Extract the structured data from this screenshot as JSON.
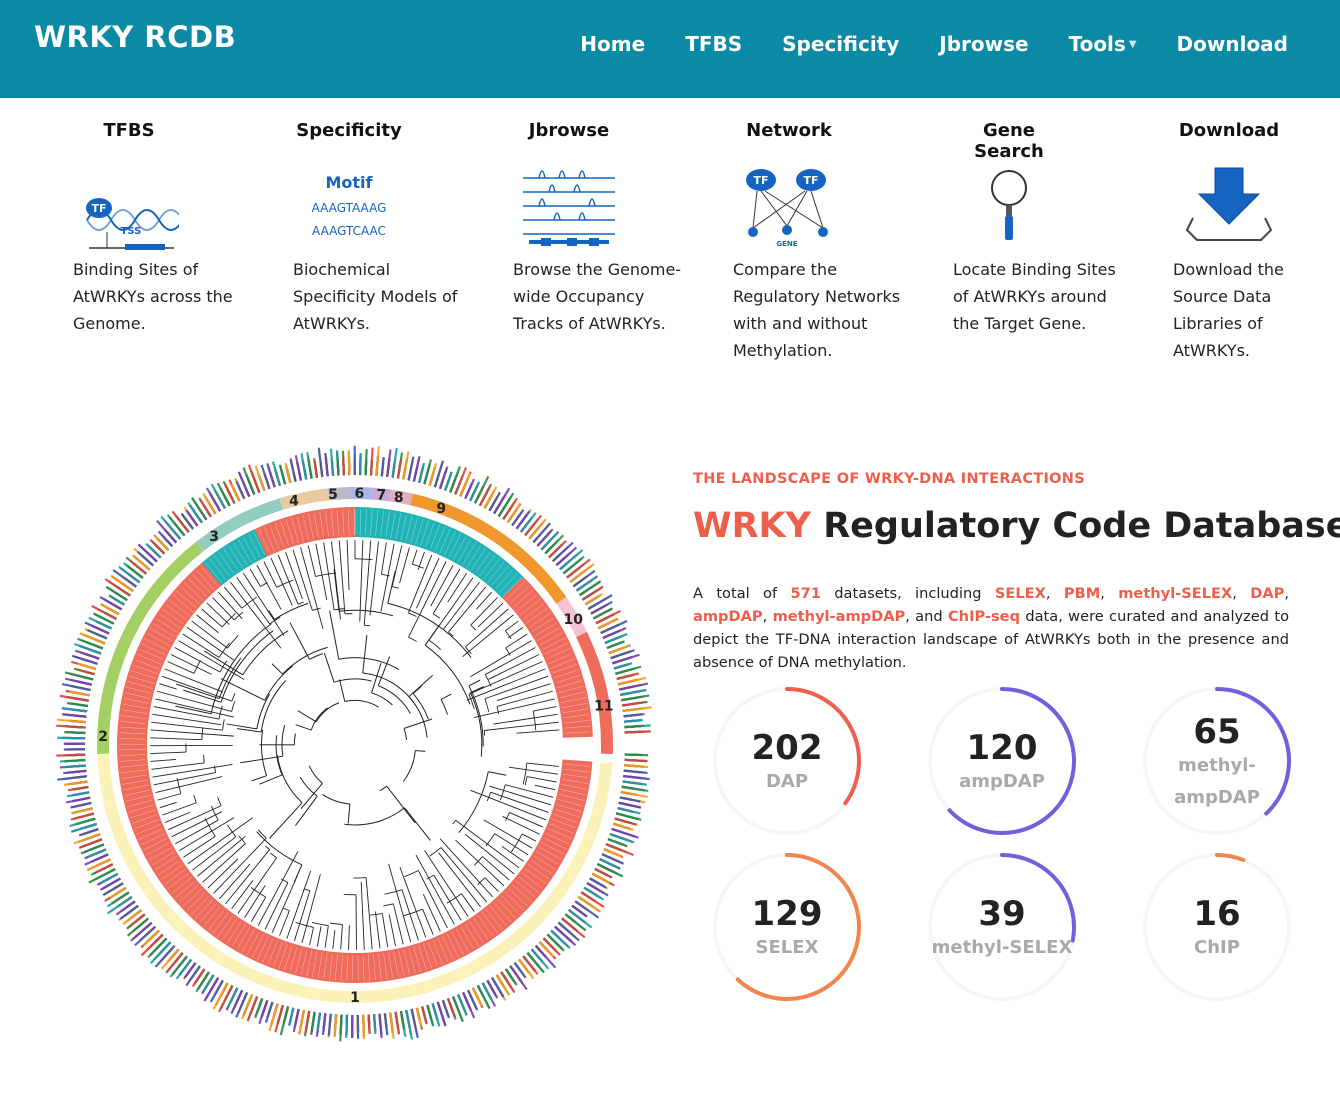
{
  "nav": {
    "brand": "WRKY RCDB",
    "items": [
      {
        "label": "Home"
      },
      {
        "label": "TFBS"
      },
      {
        "label": "Specificity"
      },
      {
        "label": "Jbrowse"
      },
      {
        "label": "Tools",
        "has_caret": true
      },
      {
        "label": "Download"
      }
    ]
  },
  "features": [
    {
      "title": "TFBS",
      "icon": "tfbs-icon",
      "desc": "Binding Sites of AtWRKYs across the Genome."
    },
    {
      "title": "Specificity",
      "icon": "motif-icon",
      "desc": "Biochemical Specificity Models of AtWRKYs."
    },
    {
      "title": "Jbrowse",
      "icon": "tracks-icon",
      "desc": "Browse the Genome-wide Occupancy Tracks of AtWRKYs."
    },
    {
      "title": "Network",
      "icon": "network-icon",
      "desc": "Compare the Regulatory Networks with and without Methylation."
    },
    {
      "title": "Gene Search",
      "icon": "magnifier-icon",
      "desc": "Locate Binding Sites of AtWRKYs around the Target Gene."
    },
    {
      "title": "Download",
      "icon": "download-icon",
      "desc": "Download the Source Data Libraries of AtWRKYs."
    }
  ],
  "icon_text": {
    "tf": "TF",
    "tss": "TSS",
    "gene": "GENE",
    "motif": "Motif",
    "seq1": "AAAGTAAAG",
    "seq2": "AAAGTCAAC"
  },
  "circle_clusters": [
    "1",
    "2",
    "3",
    "4",
    "5",
    "6",
    "7",
    "8",
    "9",
    "10",
    "11"
  ],
  "landscape": {
    "eyebrow": "THE LANDSCAPE OF WRKY-DNA INTERACTIONS",
    "title_highlight": "WRKY",
    "title_rest": " Regulatory Code Database",
    "desc": {
      "p1": "A total of ",
      "count": "571",
      "p2": " datasets, including ",
      "t1": "SELEX",
      "t2": "PBM",
      "t3": "methyl-SELEX",
      "t4": "DAP",
      "t5": "ampDAP",
      "t6": "methyl-ampDAP",
      "and": "and",
      "t7": "ChIP-seq",
      "p3": " data, were curated and analyzed to depict the TF-DNA interaction landscape of AtWRKYs both in the presence and absence of DNA methylation."
    }
  },
  "stats": [
    {
      "value": "202",
      "label": "DAP",
      "fraction": 0.35,
      "color": "#ef5e4e"
    },
    {
      "value": "120",
      "label": "ampDAP",
      "fraction": 0.63,
      "color": "#7060dc"
    },
    {
      "value": "65",
      "label_line1": "methyl-",
      "label_line2": "ampDAP",
      "fraction": 0.38,
      "color": "#7060dc"
    },
    {
      "value": "129",
      "label": "SELEX",
      "fraction": 0.62,
      "color": "#f08550"
    },
    {
      "value": "39",
      "label": "methyl-SELEX",
      "fraction": 0.28,
      "color": "#7060dc"
    },
    {
      "value": "16",
      "label": "ChIP",
      "fraction": 0.06,
      "color": "#f08550"
    }
  ]
}
